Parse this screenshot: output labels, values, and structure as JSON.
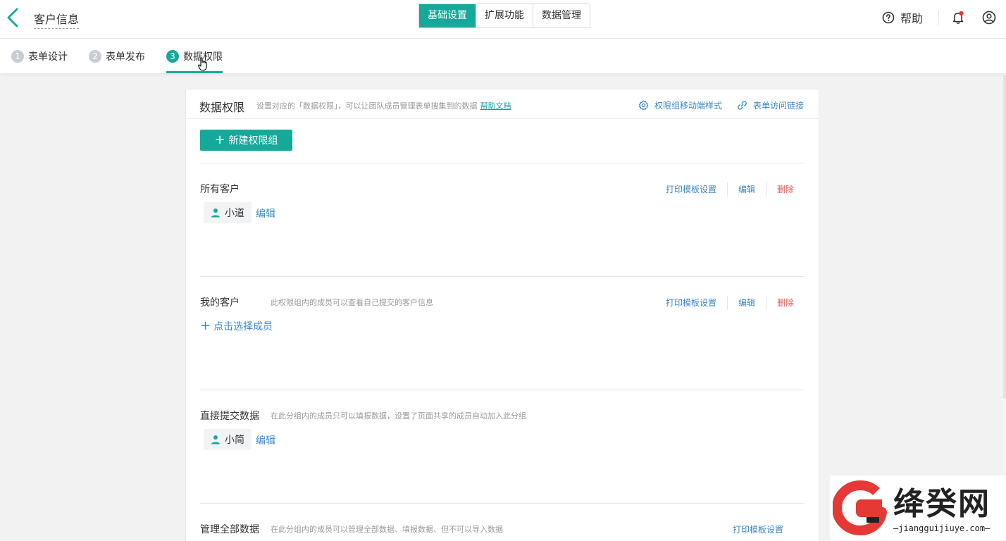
{
  "header": {
    "form_title": "客户信息",
    "mode_tabs": [
      {
        "label": "基础设置",
        "active": true
      },
      {
        "label": "扩展功能",
        "active": false
      },
      {
        "label": "数据管理",
        "active": false
      }
    ],
    "help_label": "帮助"
  },
  "steps": [
    {
      "num": "1",
      "label": "表单设计",
      "active": false
    },
    {
      "num": "2",
      "label": "表单发布",
      "active": false
    },
    {
      "num": "3",
      "label": "数据权限",
      "active": true
    }
  ],
  "panel": {
    "title": "数据权限",
    "description": "设置对应的「数据权限」，可以让团队成员管理表单搜集到的数据",
    "help_doc_link": "帮助文档",
    "mobile_style_link": "权限组移动端样式",
    "access_link": "表单访问链接",
    "new_group_label": "新建权限组"
  },
  "groups": [
    {
      "name": "所有客户",
      "desc": "",
      "actions": [
        "打印模板设置",
        "编辑",
        "删除"
      ],
      "member": "小道",
      "member_edit": "编辑"
    },
    {
      "name": "我的客户",
      "desc": "此权限组内的成员可以查看自己提交的客户信息",
      "actions": [
        "打印模板设置",
        "编辑",
        "删除"
      ],
      "add_member": "点击选择成员"
    },
    {
      "name": "直接提交数据",
      "desc": "在此分组内的成员只可以填报数据，设置了页面共享的成员自动加入此分组",
      "member": "小简",
      "member_edit": "编辑"
    },
    {
      "name": "管理全部数据",
      "desc": "在此分组内的成员可以管理全部数据、填报数据、但不可以导入数据",
      "actions": [
        "打印模板设置"
      ]
    }
  ],
  "watermark": {
    "title": "绛癸网",
    "subtitle": "jiangguijiuye.com"
  },
  "colors": {
    "accent": "#15a99a",
    "link": "#3a86c8",
    "danger": "#e05a5a",
    "notification_dot": "#e53935"
  }
}
